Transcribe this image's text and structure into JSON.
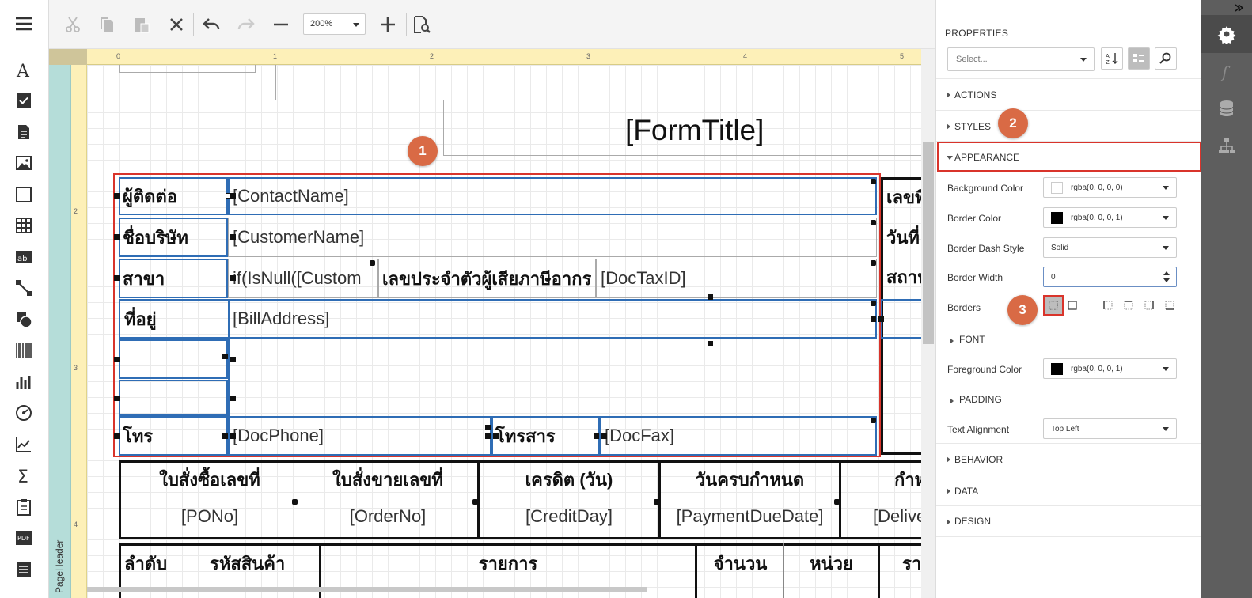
{
  "toolbar": {
    "zoom_value": "200%"
  },
  "ruler": {
    "h_marks": [
      "0",
      "1",
      "2",
      "3",
      "4",
      "5"
    ],
    "v_marks": [
      "2",
      "3",
      "4"
    ]
  },
  "band": {
    "label": "PageHeader"
  },
  "report": {
    "form_title": "[FormTitle]",
    "contact_label": "ผู้ติดต่อ",
    "contact_value": "[ContactName]",
    "company_label": "ชื่อบริษัท",
    "company_value": "[CustomerName]",
    "branch_label": "สาขา",
    "branch_value": "if(IsNull([Custom",
    "tax_label": "เลขประจำตัวผู้เสียภาษีอากร",
    "tax_value": "[DocTaxID]",
    "address_label": "ที่อยู่",
    "address_value": "[BillAddress]",
    "phone_label": "โทร",
    "phone_value": "[DocPhone]",
    "fax_label": "โทรสาร",
    "fax_value": "[DocFax]",
    "right_label_1": "เลขที่",
    "right_label_2": "วันที่",
    "right_label_3": "สถาน",
    "order_headers": [
      "ใบสั่งซื้อเลขที่",
      "ใบสั่งขายเลขที่",
      "เครดิต (วัน)",
      "วันครบกำหนด",
      "กำห"
    ],
    "order_values": [
      "[PONo]",
      "[OrderNo]",
      "[CreditDay]",
      "[PaymentDueDate]",
      "[Delive"
    ],
    "item_headers": [
      "ลำดับ",
      "รหัสสินค้า",
      "รายการ",
      "จำนวน",
      "หน่วย",
      "รา"
    ]
  },
  "markers": [
    "1",
    "2",
    "3"
  ],
  "properties": {
    "title": "PROPERTIES",
    "select_placeholder": "Select...",
    "groups": {
      "actions": "ACTIONS",
      "styles": "STYLES",
      "appearance": "APPEARANCE",
      "behavior": "BEHAVIOR",
      "data": "DATA",
      "design": "DESIGN"
    },
    "appearance": {
      "background_color_label": "Background Color",
      "background_color_value": "rgba(0, 0, 0, 0)",
      "border_color_label": "Border Color",
      "border_color_value": "rgba(0, 0, 0, 1)",
      "border_dash_label": "Border Dash Style",
      "border_dash_value": "Solid",
      "border_width_label": "Border Width",
      "border_width_value": "0",
      "borders_label": "Borders",
      "font_label": "FONT",
      "foreground_color_label": "Foreground Color",
      "foreground_color_value": "rgba(0, 0, 0, 1)",
      "padding_label": "PADDING",
      "text_alignment_label": "Text Alignment",
      "text_alignment_value": "Top Left"
    }
  },
  "colors": {
    "selection_blue": "#2f6db5",
    "highlight_red": "#d9342b",
    "marker_orange": "#d96a45",
    "tab_strip": "#5e5e5e"
  }
}
